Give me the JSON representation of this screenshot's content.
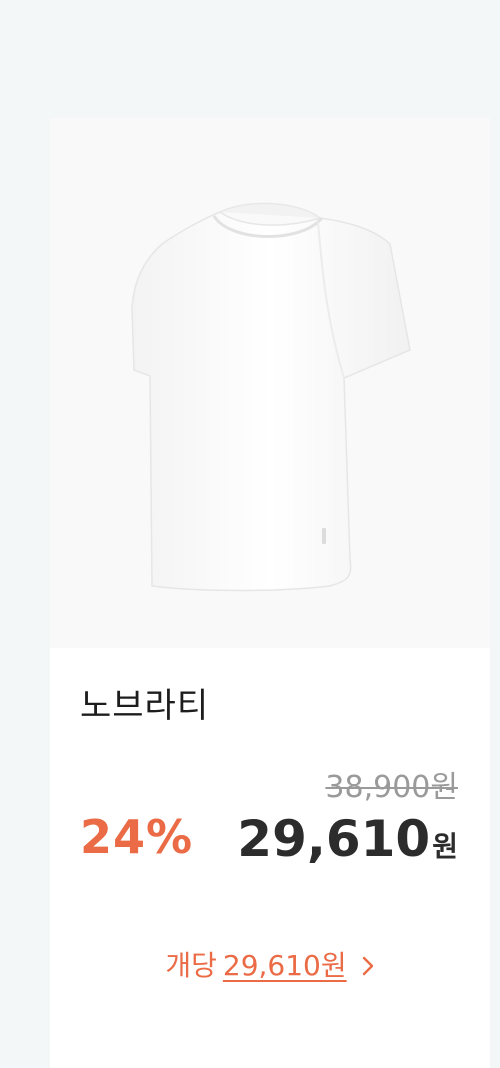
{
  "product": {
    "name": "노브라티",
    "image_alt": "white-tshirt-image",
    "original_price": "38,900원",
    "discount_rate": "24%",
    "final_price_amount": "29,610",
    "final_price_unit": "원",
    "unit_price_prefix": "개당",
    "unit_price_value": "29,610원"
  },
  "colors": {
    "accent": "#ea6b45",
    "text_primary": "#2c2c2c",
    "text_muted": "#9a9a9a",
    "page_bg": "#f4f7f8"
  },
  "icons": {
    "unit_price_chevron": "chevron-right-icon"
  }
}
